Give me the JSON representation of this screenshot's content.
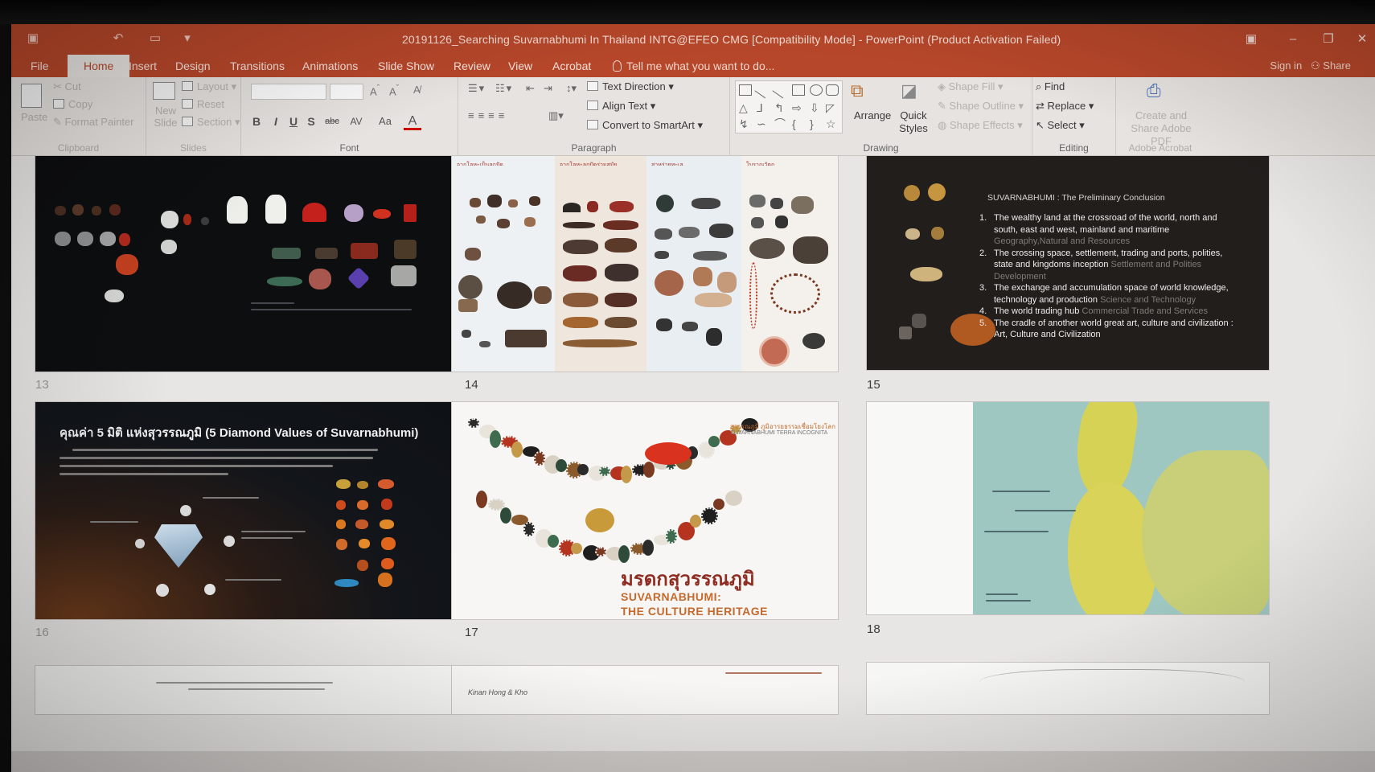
{
  "window": {
    "title": "20191126_Searching Suvarnabhumi In Thailand INTG@EFEO CMG [Compatibility Mode] - PowerPoint (Product Activation Failed)",
    "signin": "Sign in",
    "share": "Share"
  },
  "tabs": [
    "File",
    "Home",
    "Insert",
    "Design",
    "Transitions",
    "Animations",
    "Slide Show",
    "Review",
    "View",
    "Acrobat"
  ],
  "active_tab": "Home",
  "tell_me": "Tell me what you want to do...",
  "ribbon": {
    "clipboard": {
      "label": "Clipboard",
      "paste": "Paste",
      "cut": "Cut",
      "copy": "Copy",
      "format_painter": "Format Painter"
    },
    "slides": {
      "label": "Slides",
      "new_slide": "New Slide",
      "layout": "Layout",
      "reset": "Reset",
      "section": "Section"
    },
    "font": {
      "label": "Font",
      "bold": "B",
      "italic": "I",
      "underline": "U",
      "shadow": "S",
      "strike": "abc",
      "spacing": "AV",
      "case": "Aa",
      "color": "A"
    },
    "paragraph": {
      "label": "Paragraph",
      "text_direction": "Text Direction",
      "align_text": "Align Text",
      "convert_smartart": "Convert to SmartArt"
    },
    "drawing": {
      "label": "Drawing",
      "arrange": "Arrange",
      "quick_styles": "Quick Styles",
      "shape_fill": "Shape Fill",
      "shape_outline": "Shape Outline",
      "shape_effects": "Shape Effects"
    },
    "editing": {
      "label": "Editing",
      "find": "Find",
      "replace": "Replace",
      "select": "Select"
    },
    "acrobat": {
      "label": "Adobe Acrobat",
      "create_share": "Create and Share Adobe PDF"
    }
  },
  "slides": [
    {
      "number": "13",
      "caption": ""
    },
    {
      "number": "14",
      "columns": [
        "จากโลหะเป็นลูกปัด",
        "จากโลหะลูกปัดร่วมสมัย",
        "สาหร่ายทะเล",
        "โบราณวัตถุ"
      ]
    },
    {
      "number": "15",
      "title": "SUVARNABHUMI : The Preliminary Conclusion",
      "items": [
        {
          "n": "1.",
          "text": "The wealthy land at the crossroad of the world, north and south, east and west, mainland and maritime",
          "tail": "Geography,Natural and Resources"
        },
        {
          "n": "2.",
          "text": "The crossing space, settlement, trading and ports, polities, state and kingdoms inception",
          "tail": "Settlement and Polities Development"
        },
        {
          "n": "3.",
          "text": "The exchange and accumulation space of world knowledge, technology and production",
          "tail": "Science and Technology"
        },
        {
          "n": "4.",
          "text": "The world trading hub",
          "tail": "Commercial Trade and Services"
        },
        {
          "n": "5.",
          "text": "The cradle of another world great art, culture and civilization : Art, Culture and Civilization",
          "tail": ""
        }
      ]
    },
    {
      "number": "16",
      "title": "คุณค่า 5 มิติ แห่งสุวรรณภูมิ (5 Diamond Values of Suvarnabhumi)"
    },
    {
      "number": "17",
      "kicker_thai": "สุวรรณภูมิ ภูมิอารยธรรมเชื่อมโยงโลก",
      "kicker": "SUVARNABHUMI TERRA INCOGNITA",
      "title_thai": "มรดกสุวรรณภูมิ",
      "title_en_1": "SUVARNABHUMI:",
      "title_en_2": "THE CULTURE HERITAGE"
    },
    {
      "number": "18"
    }
  ],
  "partial_row": {
    "slide_20_text": "Kinan Hong & Kho"
  },
  "colors": {
    "ppt_red": "#b7472a",
    "ribbon_bg": "#e6e3e0",
    "sorter_bg": "#e8e6e4",
    "s17_title_red": "#8f2d22",
    "s17_subtitle_orange": "#c46a2e"
  }
}
